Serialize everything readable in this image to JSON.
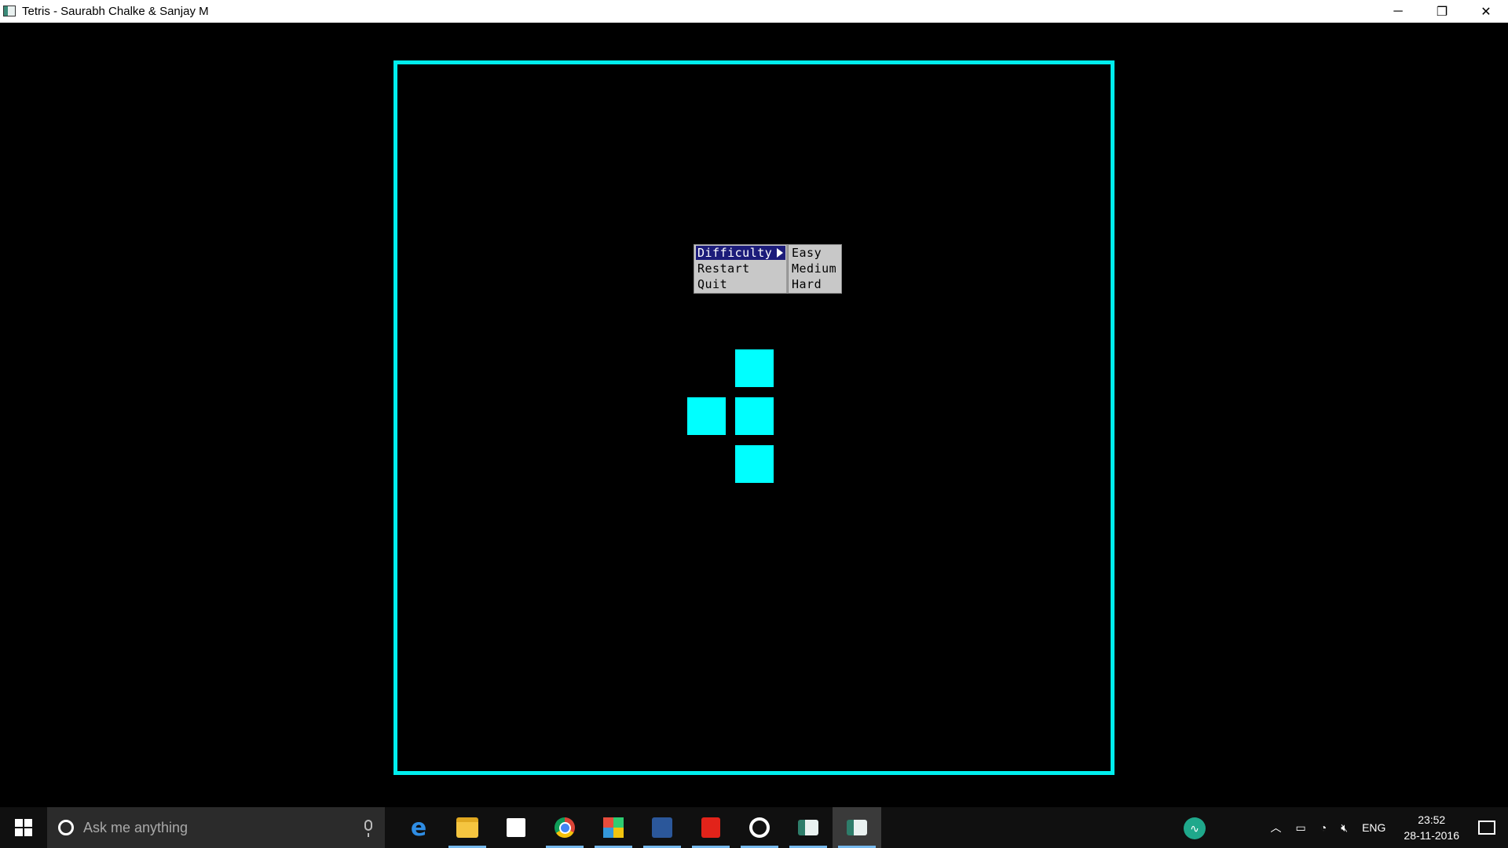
{
  "window": {
    "title": "Tetris - Saurabh Chalke & Sanjay M",
    "controls": {
      "minimize": "─",
      "restore": "❐",
      "close": "✕"
    }
  },
  "menu": {
    "items": [
      {
        "label": "Difficulty",
        "active": true,
        "has_submenu": true
      },
      {
        "label": "Restart"
      },
      {
        "label": "Quit"
      }
    ],
    "submenu": [
      "Easy",
      "Medium",
      "Hard"
    ]
  },
  "game": {
    "board_color": "#00eeee",
    "piece_color": "#00ffff",
    "piece_shape": "T"
  },
  "taskbar": {
    "search_placeholder": "Ask me anything",
    "icons": [
      "edge-icon",
      "file-explorer-icon",
      "store-icon",
      "chrome-icon",
      "office-icon",
      "word-icon",
      "acrobat-icon",
      "whatsapp-icon",
      "app-icon",
      "tetris-icon"
    ],
    "tray": {
      "language": "ENG",
      "time": "23:52",
      "date": "28-11-2016"
    }
  }
}
